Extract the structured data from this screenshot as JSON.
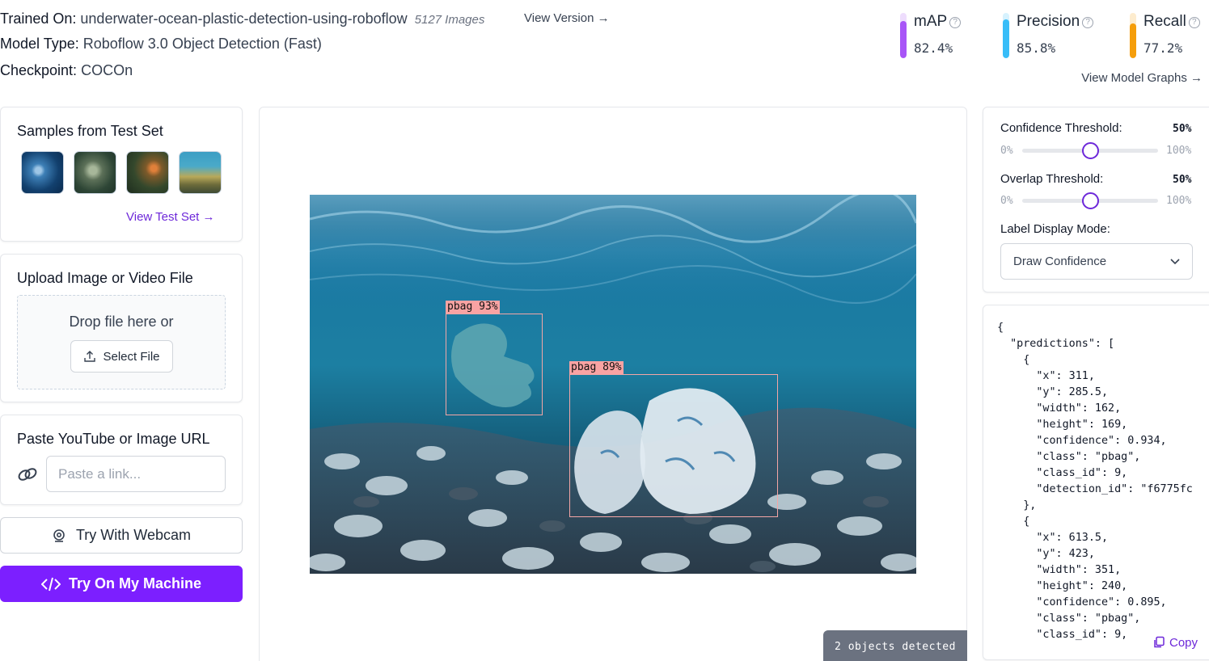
{
  "model_info": {
    "trained_on_label": "Trained On:",
    "trained_on_value": "underwater-ocean-plastic-detection-using-roboflow",
    "images_count": "5127 Images",
    "view_version": "View Version",
    "model_type_label": "Model Type:",
    "model_type_value": "Roboflow 3.0 Object Detection (Fast)",
    "checkpoint_label": "Checkpoint:",
    "checkpoint_value": "COCOn"
  },
  "metrics": [
    {
      "name": "mAP",
      "value": "82.4%",
      "fraction": 0.824,
      "color": "#a855f7"
    },
    {
      "name": "Precision",
      "value": "85.8%",
      "fraction": 0.858,
      "color": "#38bdf8"
    },
    {
      "name": "Recall",
      "value": "77.2%",
      "fraction": 0.772,
      "color": "#f59e0b"
    }
  ],
  "view_model_graphs": "View Model Graphs",
  "samples": {
    "title": "Samples from Test Set",
    "view_test_set": "View Test Set"
  },
  "upload": {
    "title": "Upload Image or Video File",
    "drop_text": "Drop file here or",
    "select_button": "Select File"
  },
  "paste_url": {
    "title": "Paste YouTube or Image URL",
    "placeholder": "Paste a link..."
  },
  "webcam_button": "Try With Webcam",
  "machine_button": "Try On My Machine",
  "detections": [
    {
      "label": "pbag 93%"
    },
    {
      "label": "pbag 89%"
    }
  ],
  "objects_detected": "2 objects detected",
  "controls": {
    "confidence_label": "Confidence Threshold:",
    "confidence_value": "50%",
    "confidence_fraction": 0.5,
    "overlap_label": "Overlap Threshold:",
    "overlap_value": "50%",
    "overlap_fraction": 0.5,
    "min_label": "0%",
    "max_label": "100%",
    "label_mode_label": "Label Display Mode:",
    "label_mode_value": "Draw Confidence"
  },
  "json_output": "{\n  \"predictions\": [\n    {\n      \"x\": 311,\n      \"y\": 285.5,\n      \"width\": 162,\n      \"height\": 169,\n      \"confidence\": 0.934,\n      \"class\": \"pbag\",\n      \"class_id\": 9,\n      \"detection_id\": \"f6775fc\n    },\n    {\n      \"x\": 613.5,\n      \"y\": 423,\n      \"width\": 351,\n      \"height\": 240,\n      \"confidence\": 0.895,\n      \"class\": \"pbag\",\n      \"class_id\": 9,",
  "copy_label": "Copy"
}
